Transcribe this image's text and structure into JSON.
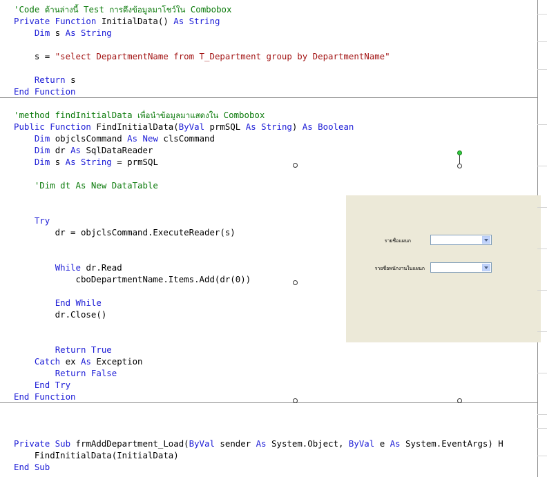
{
  "block1": [
    {
      "parts": [
        {
          "t": "'Code ",
          "c": "cm"
        },
        {
          "t": "ด้านล่างนี้",
          "c": "cm th"
        },
        {
          "t": " Test ",
          "c": "cm"
        },
        {
          "t": "การดึงข้อมูลมาโชว์ใน",
          "c": "cm th"
        },
        {
          "t": " Combobox",
          "c": "cm"
        }
      ]
    },
    {
      "parts": [
        {
          "t": "Private Function",
          "c": "kw"
        },
        {
          "t": " InitialData() ",
          "c": ""
        },
        {
          "t": "As String",
          "c": "kw"
        }
      ]
    },
    {
      "parts": [
        {
          "t": "    ",
          "c": ""
        },
        {
          "t": "Dim",
          "c": "kw"
        },
        {
          "t": " s ",
          "c": ""
        },
        {
          "t": "As String",
          "c": "kw"
        }
      ]
    },
    {
      "parts": []
    },
    {
      "parts": [
        {
          "t": "    s = ",
          "c": ""
        },
        {
          "t": "\"select DepartmentName from T_Department group by DepartmentName\"",
          "c": "st"
        }
      ]
    },
    {
      "parts": []
    },
    {
      "parts": [
        {
          "t": "    ",
          "c": ""
        },
        {
          "t": "Return",
          "c": "kw"
        },
        {
          "t": " s",
          "c": ""
        }
      ]
    },
    {
      "parts": [
        {
          "t": "End Function",
          "c": "kw"
        }
      ]
    }
  ],
  "block2": [
    {
      "parts": [
        {
          "t": "'method findInitialData ",
          "c": "cm"
        },
        {
          "t": "เพื่อนำข้อมูลมาแสดงใน",
          "c": "cm th"
        },
        {
          "t": " Combobox",
          "c": "cm"
        }
      ]
    },
    {
      "parts": [
        {
          "t": "Public Function",
          "c": "kw"
        },
        {
          "t": " FindInitialData(",
          "c": ""
        },
        {
          "t": "ByVal",
          "c": "kw"
        },
        {
          "t": " prmSQL ",
          "c": ""
        },
        {
          "t": "As String",
          "c": "kw"
        },
        {
          "t": ") ",
          "c": ""
        },
        {
          "t": "As Boolean",
          "c": "kw"
        }
      ]
    },
    {
      "parts": [
        {
          "t": "    ",
          "c": ""
        },
        {
          "t": "Dim",
          "c": "kw"
        },
        {
          "t": " objclsCommand ",
          "c": ""
        },
        {
          "t": "As New",
          "c": "kw"
        },
        {
          "t": " clsCommand",
          "c": ""
        }
      ]
    },
    {
      "parts": [
        {
          "t": "    ",
          "c": ""
        },
        {
          "t": "Dim",
          "c": "kw"
        },
        {
          "t": " dr ",
          "c": ""
        },
        {
          "t": "As",
          "c": "kw"
        },
        {
          "t": " SqlDataReader",
          "c": ""
        }
      ]
    },
    {
      "parts": [
        {
          "t": "    ",
          "c": ""
        },
        {
          "t": "Dim",
          "c": "kw"
        },
        {
          "t": " s ",
          "c": ""
        },
        {
          "t": "As String",
          "c": "kw"
        },
        {
          "t": " = prmSQL",
          "c": ""
        }
      ]
    },
    {
      "parts": []
    },
    {
      "parts": [
        {
          "t": "    'Dim dt As New DataTable",
          "c": "cm"
        }
      ]
    },
    {
      "parts": []
    },
    {
      "parts": []
    },
    {
      "parts": [
        {
          "t": "    ",
          "c": ""
        },
        {
          "t": "Try",
          "c": "kw"
        }
      ]
    },
    {
      "parts": [
        {
          "t": "        dr = objclsCommand.ExecuteReader(s)",
          "c": ""
        }
      ]
    },
    {
      "parts": []
    },
    {
      "parts": []
    },
    {
      "parts": [
        {
          "t": "        ",
          "c": ""
        },
        {
          "t": "While",
          "c": "kw"
        },
        {
          "t": " dr.Read",
          "c": ""
        }
      ]
    },
    {
      "parts": [
        {
          "t": "            cboDepartmentName.Items.Add(dr(0))",
          "c": ""
        }
      ]
    },
    {
      "parts": []
    },
    {
      "parts": [
        {
          "t": "        ",
          "c": ""
        },
        {
          "t": "End While",
          "c": "kw"
        }
      ]
    },
    {
      "parts": [
        {
          "t": "        dr.Close()",
          "c": ""
        }
      ]
    },
    {
      "parts": []
    },
    {
      "parts": []
    },
    {
      "parts": [
        {
          "t": "        ",
          "c": ""
        },
        {
          "t": "Return True",
          "c": "kw"
        }
      ]
    },
    {
      "parts": [
        {
          "t": "    ",
          "c": ""
        },
        {
          "t": "Catch",
          "c": "kw"
        },
        {
          "t": " ex ",
          "c": ""
        },
        {
          "t": "As",
          "c": "kw"
        },
        {
          "t": " Exception",
          "c": ""
        }
      ]
    },
    {
      "parts": [
        {
          "t": "        ",
          "c": ""
        },
        {
          "t": "Return False",
          "c": "kw"
        }
      ]
    },
    {
      "parts": [
        {
          "t": "    ",
          "c": ""
        },
        {
          "t": "End Try",
          "c": "kw"
        }
      ]
    },
    {
      "parts": [
        {
          "t": "End Function",
          "c": "kw"
        }
      ]
    }
  ],
  "block3": [
    {
      "parts": [
        {
          "t": "Private Sub",
          "c": "kw"
        },
        {
          "t": " frmAddDepartment_Load(",
          "c": ""
        },
        {
          "t": "ByVal",
          "c": "kw"
        },
        {
          "t": " sender ",
          "c": ""
        },
        {
          "t": "As",
          "c": "kw"
        },
        {
          "t": " System.Object, ",
          "c": ""
        },
        {
          "t": "ByVal",
          "c": "kw"
        },
        {
          "t": " e ",
          "c": ""
        },
        {
          "t": "As",
          "c": "kw"
        },
        {
          "t": " System.EventArgs) H",
          "c": ""
        }
      ]
    },
    {
      "parts": [
        {
          "t": "    FindInitialData(InitialData)",
          "c": ""
        }
      ]
    },
    {
      "parts": [
        {
          "t": "End Sub",
          "c": "kw"
        }
      ]
    }
  ],
  "form": {
    "label_department": "รายชื่อแผนก",
    "label_employee": "รายชื่อพนักงานในแผนก",
    "combo_department_value": "",
    "combo_employee_value": ""
  }
}
